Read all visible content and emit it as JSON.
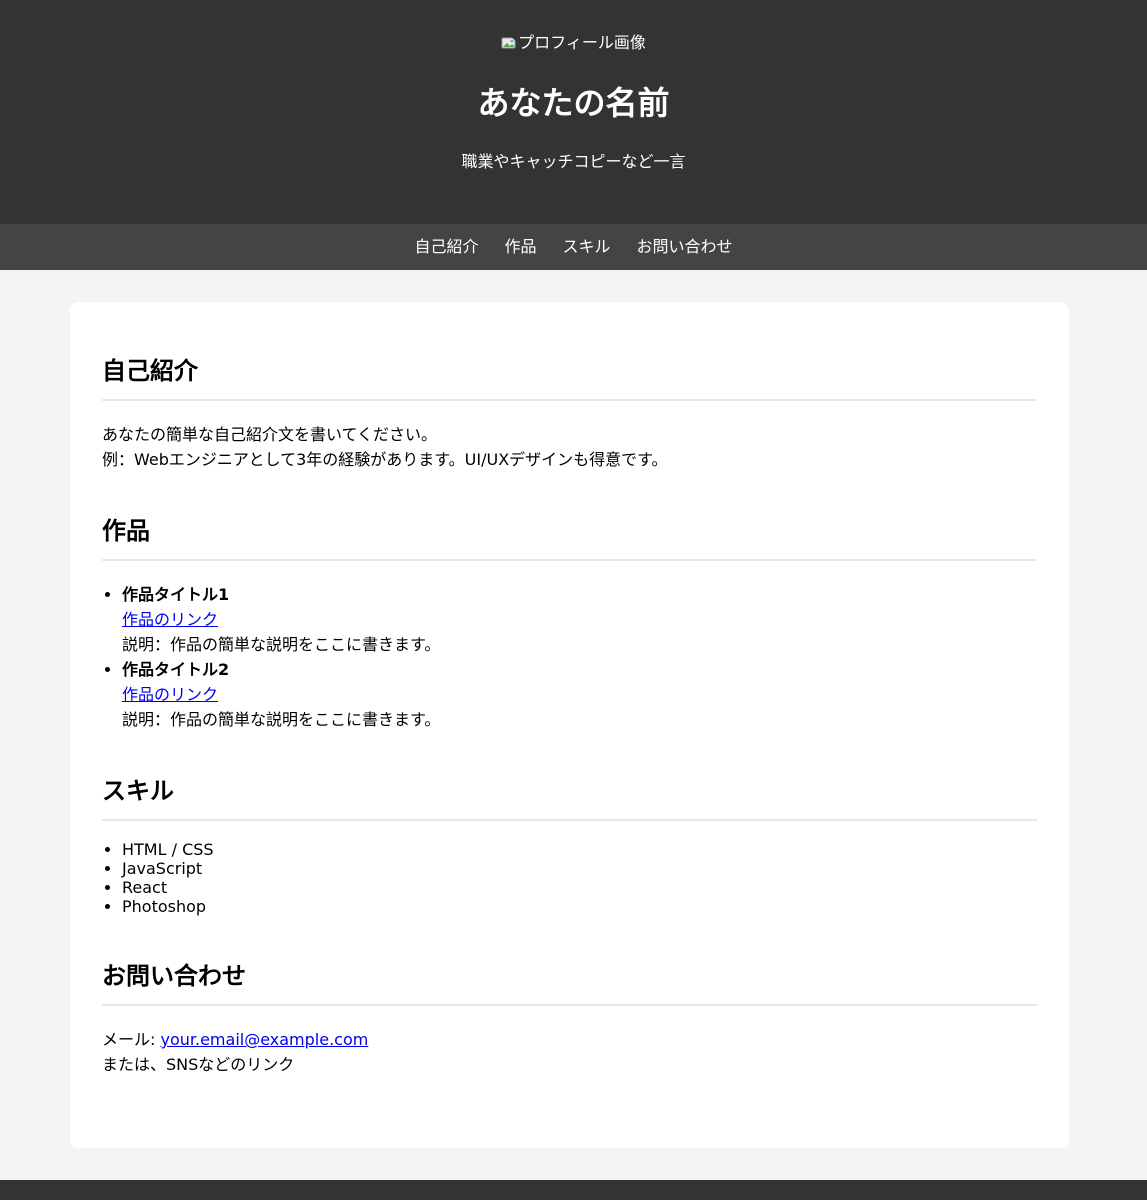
{
  "header": {
    "profile_image_alt": "プロフィール画像",
    "name": "あなたの名前",
    "tagline": "職業やキャッチコピーなど一言"
  },
  "nav": {
    "items": [
      {
        "label": "自己紹介"
      },
      {
        "label": "作品"
      },
      {
        "label": "スキル"
      },
      {
        "label": "お問い合わせ"
      }
    ]
  },
  "about": {
    "heading": "自己紹介",
    "lines": [
      "あなたの簡単な自己紹介文を書いてください。",
      "例：Webエンジニアとして3年の経験があります。UI/UXデザインも得意です。"
    ]
  },
  "works": {
    "heading": "作品",
    "items": [
      {
        "title": "作品タイトル1",
        "link_text": "作品のリンク",
        "description": "説明：作品の簡単な説明をここに書きます。"
      },
      {
        "title": "作品タイトル2",
        "link_text": "作品のリンク",
        "description": "説明：作品の簡単な説明をここに書きます。"
      }
    ]
  },
  "skills": {
    "heading": "スキル",
    "items": [
      "HTML / CSS",
      "JavaScript",
      "React",
      "Photoshop"
    ]
  },
  "contact": {
    "heading": "お問い合わせ",
    "email_label": "メール: ",
    "email": "your.email@example.com",
    "other": "または、SNSなどのリンク"
  },
  "colors": {
    "header_bg": "#333333",
    "nav_bg": "#444444",
    "page_bg": "#f4f4f4",
    "link": "#0000ee"
  }
}
